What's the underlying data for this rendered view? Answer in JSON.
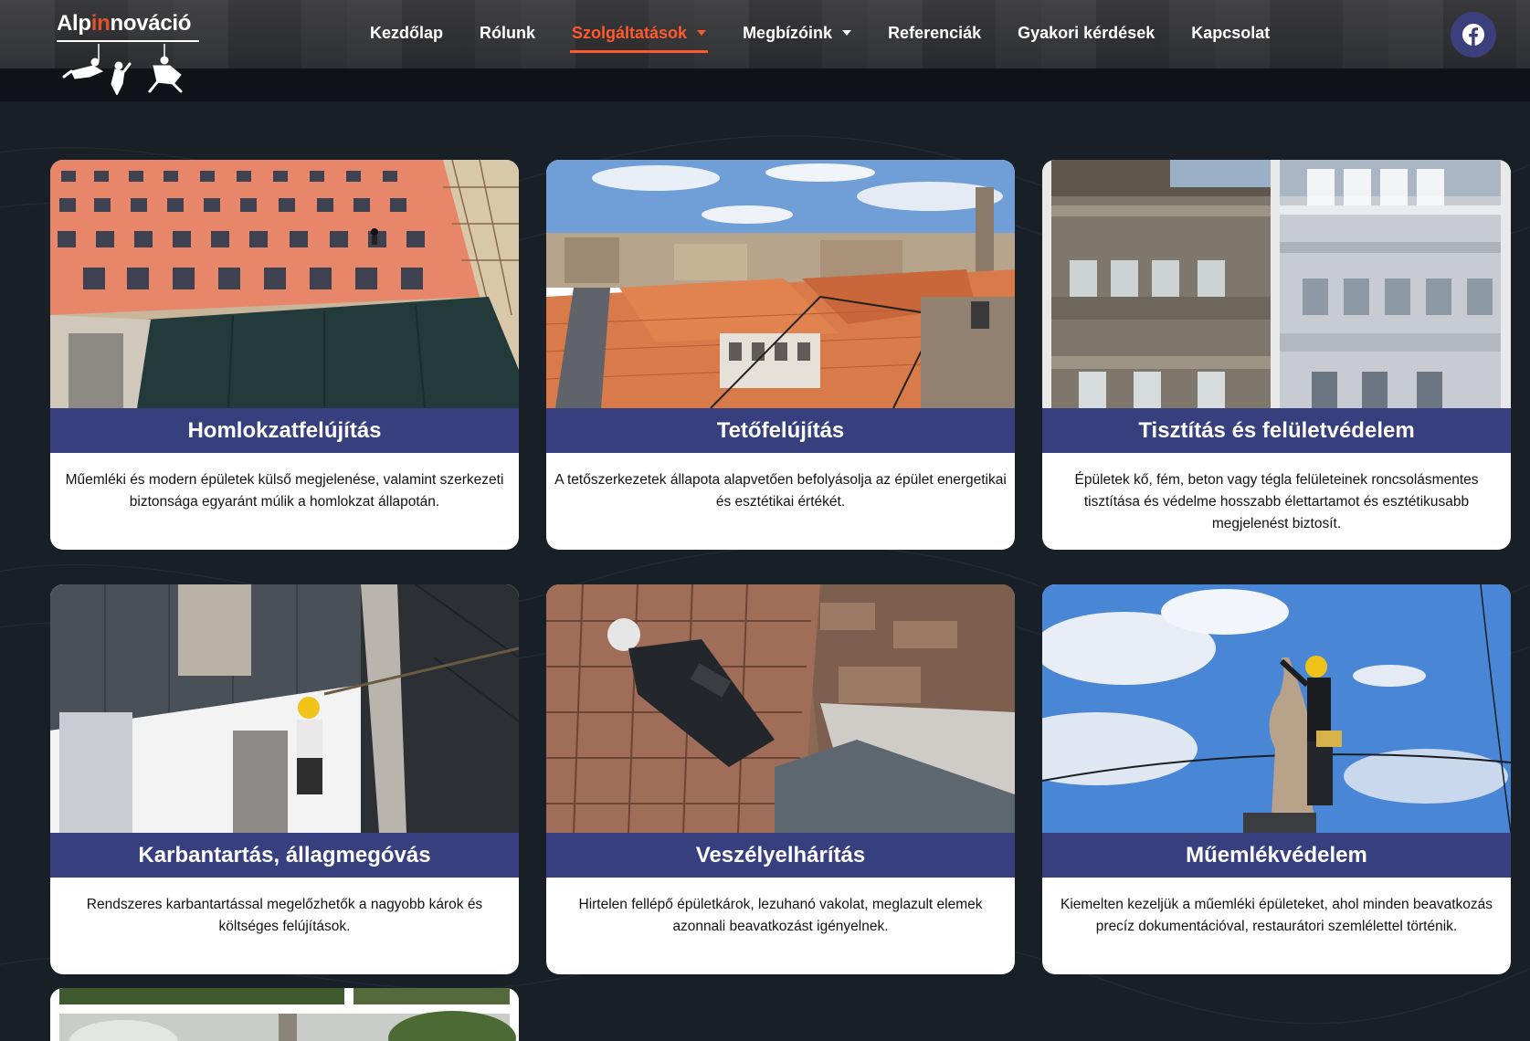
{
  "logo": {
    "part1": "Alp",
    "part2": "in",
    "part3": "nováció"
  },
  "nav": {
    "items": [
      {
        "label": "Kezdőlap",
        "dropdown": false,
        "active": false
      },
      {
        "label": "Rólunk",
        "dropdown": false,
        "active": false
      },
      {
        "label": "Szolgáltatások",
        "dropdown": true,
        "active": true
      },
      {
        "label": "Megbízóink",
        "dropdown": true,
        "active": false
      },
      {
        "label": "Referenciák",
        "dropdown": false,
        "active": false
      },
      {
        "label": "Gyakori kérdések",
        "dropdown": false,
        "active": false
      },
      {
        "label": "Kapcsolat",
        "dropdown": false,
        "active": false
      }
    ],
    "social_icon": "facebook-icon"
  },
  "colors": {
    "accent": "#ff5a2b",
    "title_bar": "#383f7e",
    "page_bg": "#191f27",
    "social_button": "#3b3f7c"
  },
  "services": [
    {
      "title": "Homlokzatfelújítás",
      "description": "Műemléki és modern épületek külső megjelenése, valamint szerkezeti biztonsága egyaránt múlik a homlokzat állapotán."
    },
    {
      "title": "Tetőfelújítás",
      "description": "A tetőszerkezetek állapota alapvetően befolyásolja az épület energetikai és esztétikai értékét."
    },
    {
      "title": "Tisztítás és felületvédelem",
      "description": "Épületek kő, fém, beton vagy tégla felületeinek roncsolásmentes tisztítása és védelme hosszabb élettartamot és esztétikusabb megjelenést biztosít."
    },
    {
      "title": "Karbantartás, állagmegóvás",
      "description": "Rendszeres karbantartással megelőzhetők a nagyobb károk és költséges felújítások."
    },
    {
      "title": "Veszélyelhárítás",
      "description": "Hirtelen fellépő épületkárok, lezuhanó vakolat, meglazult elemek azonnali beavatkozást igényelnek."
    },
    {
      "title": "Műemlékvédelem",
      "description": "Kiemelten kezeljük a műemléki épületeket, ahol minden beavatkozás precíz dokumentációval, restaurátori szemlélettel történik."
    }
  ]
}
